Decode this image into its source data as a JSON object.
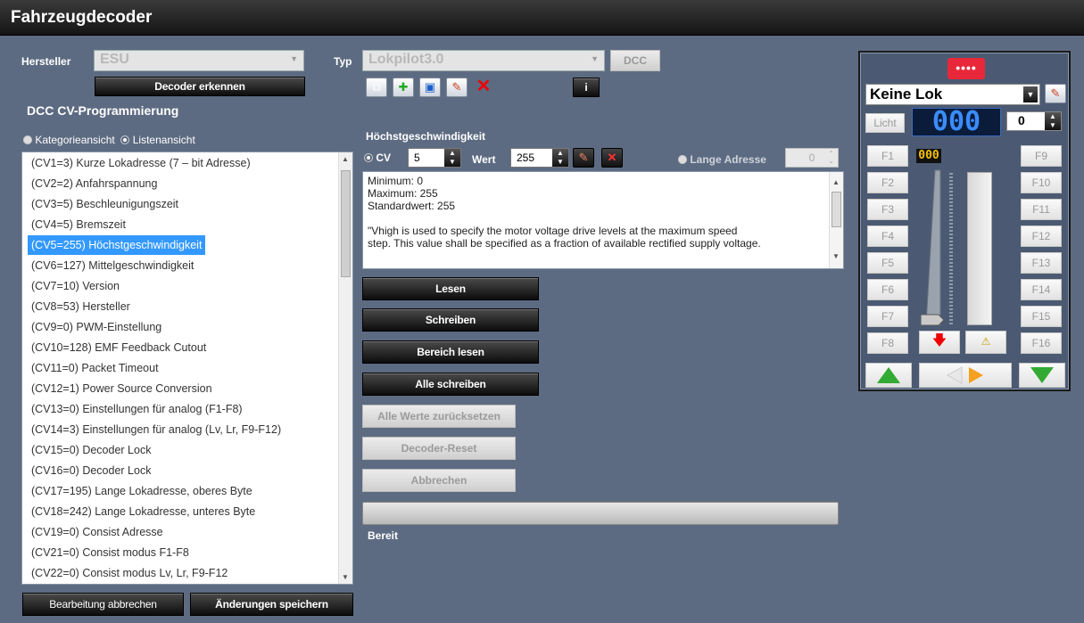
{
  "window": {
    "title": "Fahrzeugdecoder"
  },
  "manufacturer": {
    "label": "Hersteller",
    "value": "ESU"
  },
  "type": {
    "label": "Typ",
    "value": "Lokpilot3.0",
    "protocol": "DCC"
  },
  "detect_button": "Decoder erkennen",
  "section_title": "DCC CV-Programmierung",
  "view_toggle": {
    "category": "Kategorieansicht",
    "list": "Listenansicht"
  },
  "cv_list": [
    "(CV1=3) Kurze Lokadresse (7 – bit Adresse)",
    "(CV2=2) Anfahrspannung",
    "(CV3=5) Beschleunigungszeit",
    "(CV4=5) Bremszeit",
    "(CV5=255) Höchstgeschwindigkeit",
    "(CV6=127) Mittelgeschwindigkeit",
    "(CV7=10) Version",
    "(CV8=53) Hersteller",
    "(CV9=0) PWM-Einstellung",
    "(CV10=128) EMF Feedback Cutout",
    "(CV11=0) Packet Timeout",
    "(CV12=1) Power Source Conversion",
    "(CV13=0) Einstellungen für analog (F1-F8)",
    "(CV14=3) Einstellungen für analog (Lv, Lr, F9-F12)",
    "(CV15=0) Decoder Lock",
    "(CV16=0) Decoder Lock",
    "(CV17=195) Lange Lokadresse, oberes Byte",
    "(CV18=242) Lange Lokadresse, unteres Byte",
    "(CV19=0) Consist Adresse",
    "(CV21=0) Consist modus F1-F8",
    "(CV22=0) Consist modus Lv, Lr, F9-F12"
  ],
  "selected_index": 4,
  "detail": {
    "title": "Höchstgeschwindigkeit",
    "cv_label": "CV",
    "cv_value": "5",
    "value_label": "Wert",
    "value": "255",
    "long_addr_label": "Lange Adresse",
    "long_addr_value": "0",
    "description": [
      "Minimum: 0",
      "Maximum: 255",
      "Standardwert: 255",
      "",
      "\"Vhigh is used to specify the motor voltage drive levels at the maximum speed",
      "step. This value shall be specified as a fraction of available rectified supply voltage."
    ]
  },
  "actions": {
    "read": "Lesen",
    "write": "Schreiben",
    "read_range": "Bereich lesen",
    "write_all": "Alle schreiben",
    "reset_values": "Alle Werte zurücksetzen",
    "decoder_reset": "Decoder-Reset",
    "abort": "Abbrechen"
  },
  "status": "Bereit",
  "bottom": {
    "cancel_edit": "Bearbeitung abbrechen",
    "save_changes": "Änderungen speichern"
  },
  "throttle": {
    "loco": "Keine Lok",
    "light": "Licht",
    "address": "000",
    "step": "0",
    "speed": "000",
    "fkeys_left": [
      "F1",
      "F2",
      "F3",
      "F4",
      "F5",
      "F6",
      "F7",
      "F8"
    ],
    "fkeys_right": [
      "F9",
      "F10",
      "F11",
      "F12",
      "F13",
      "F14",
      "F15",
      "F16"
    ],
    "speed_fraction": 0
  }
}
